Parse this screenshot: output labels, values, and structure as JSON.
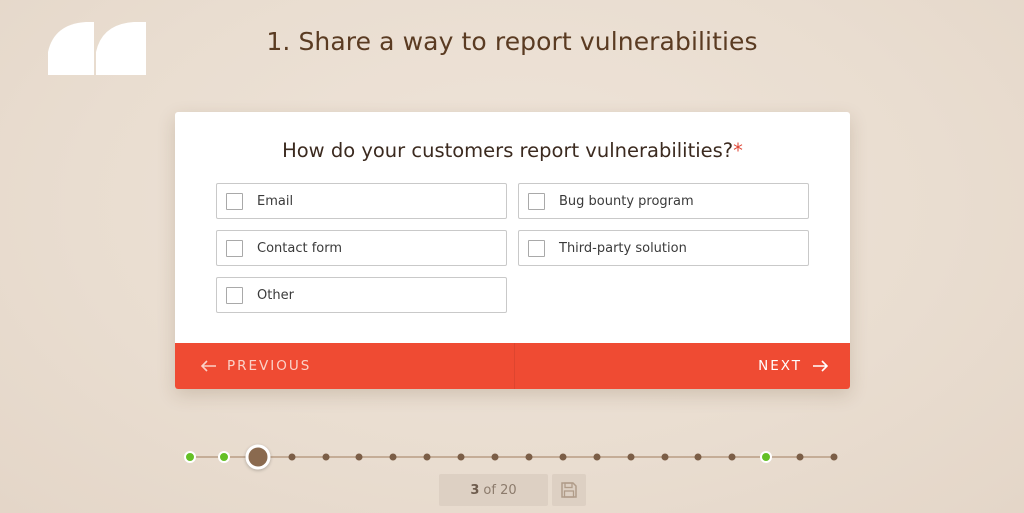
{
  "page": {
    "title": "1. Share a way to report vulnerabilities"
  },
  "question": {
    "text": "How do your customers report vulnerabilities?",
    "required_marker": "*"
  },
  "options": [
    {
      "label": "Email",
      "checked": false
    },
    {
      "label": "Bug bounty program",
      "checked": false
    },
    {
      "label": "Contact form",
      "checked": false
    },
    {
      "label": "Third-party solution",
      "checked": false
    },
    {
      "label": "Other",
      "checked": false
    }
  ],
  "nav": {
    "previous_label": "PREVIOUS",
    "next_label": "NEXT",
    "previous_icon": "arrow-left-icon",
    "next_icon": "arrow-right-icon"
  },
  "progress": {
    "current": "3",
    "of_text": "of 20",
    "steps": [
      "done",
      "done",
      "current",
      "todo",
      "todo",
      "todo",
      "todo",
      "todo",
      "todo",
      "todo",
      "todo",
      "todo",
      "todo",
      "todo",
      "todo",
      "todo",
      "todo",
      "done",
      "todo",
      "todo"
    ]
  },
  "save": {
    "icon": "save-icon"
  },
  "colors": {
    "accent": "#ef4b33",
    "done": "#64c026",
    "required": "#e04a3a",
    "background": "#e9ddd0"
  }
}
